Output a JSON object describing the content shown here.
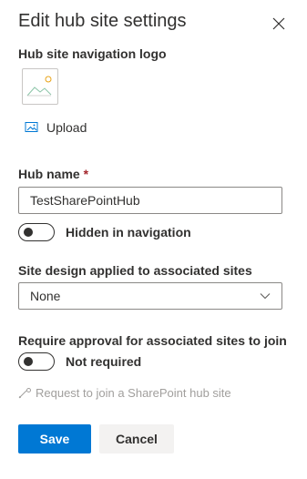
{
  "panel": {
    "title": "Edit hub site settings",
    "close_icon": "close-icon"
  },
  "logo": {
    "label": "Hub site navigation logo",
    "placeholder_icon": "image-placeholder-icon",
    "upload_label": "Upload",
    "upload_icon": "image-upload-icon"
  },
  "hub_name": {
    "label": "Hub name",
    "required_marker": "*",
    "value": "TestSharePointHub"
  },
  "hidden_nav": {
    "label": "Hidden in navigation",
    "state": "off"
  },
  "site_design": {
    "label": "Site design applied to associated sites",
    "selected": "None",
    "chevron_icon": "chevron-down-icon"
  },
  "approval": {
    "label": "Require approval for associated sites to join",
    "toggle_label": "Not required",
    "state": "off"
  },
  "request_link": {
    "label": "Request to join a SharePoint hub site",
    "icon": "link-icon",
    "disabled": true
  },
  "footer": {
    "save_label": "Save",
    "cancel_label": "Cancel"
  },
  "colors": {
    "primary": "#0078d4",
    "text": "#323130",
    "disabled_text": "#a19f9d",
    "required": "#a4262c",
    "border": "#8a8886"
  }
}
